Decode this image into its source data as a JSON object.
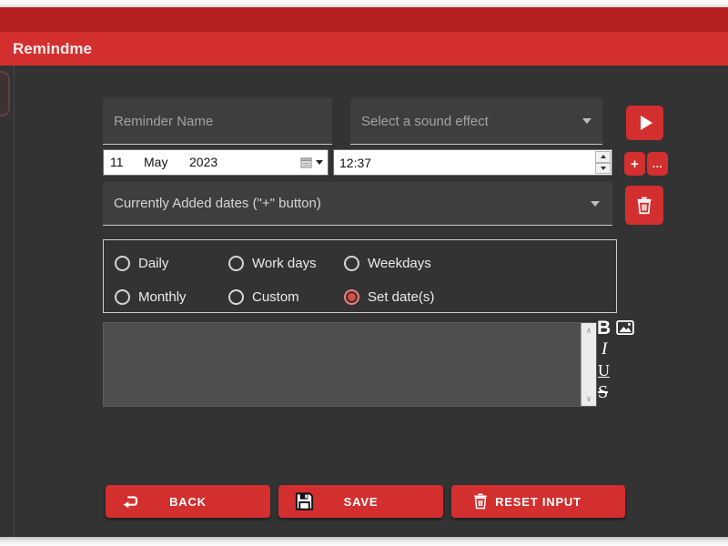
{
  "titlebar": {
    "app_title": "Remindme"
  },
  "form": {
    "reminder_name_placeholder": "Reminder Name",
    "sound_placeholder": "Select a sound effect",
    "date": {
      "day": "11",
      "month": "May",
      "year": "2023"
    },
    "time": "12:37",
    "dates_dropdown_label": "Currently Added dates (\"+\" button)",
    "recurrence_options": [
      {
        "label": "Daily",
        "selected": false
      },
      {
        "label": "Work days",
        "selected": false
      },
      {
        "label": "Weekdays",
        "selected": false
      },
      {
        "label": "Monthly",
        "selected": false
      },
      {
        "label": "Custom",
        "selected": false
      },
      {
        "label": "Set date(s)",
        "selected": true
      }
    ],
    "note_text": "",
    "side_buttons": {
      "add_label": "+",
      "more_label": "..."
    },
    "format_tools": {
      "bold": "B",
      "italic": "I",
      "underline": "U",
      "strikethrough": "S"
    }
  },
  "footer_buttons": {
    "back": "BACK",
    "save": "SAVE",
    "reset": "RESET INPUT"
  },
  "colors": {
    "accent_red": "#d32f2f",
    "titlebar_dark_red": "#b51f1f",
    "background": "#333333",
    "field_background": "#3e3e3e",
    "selected_radio_ring": "#ef837a",
    "selected_radio_dot": "#dd4b41"
  }
}
